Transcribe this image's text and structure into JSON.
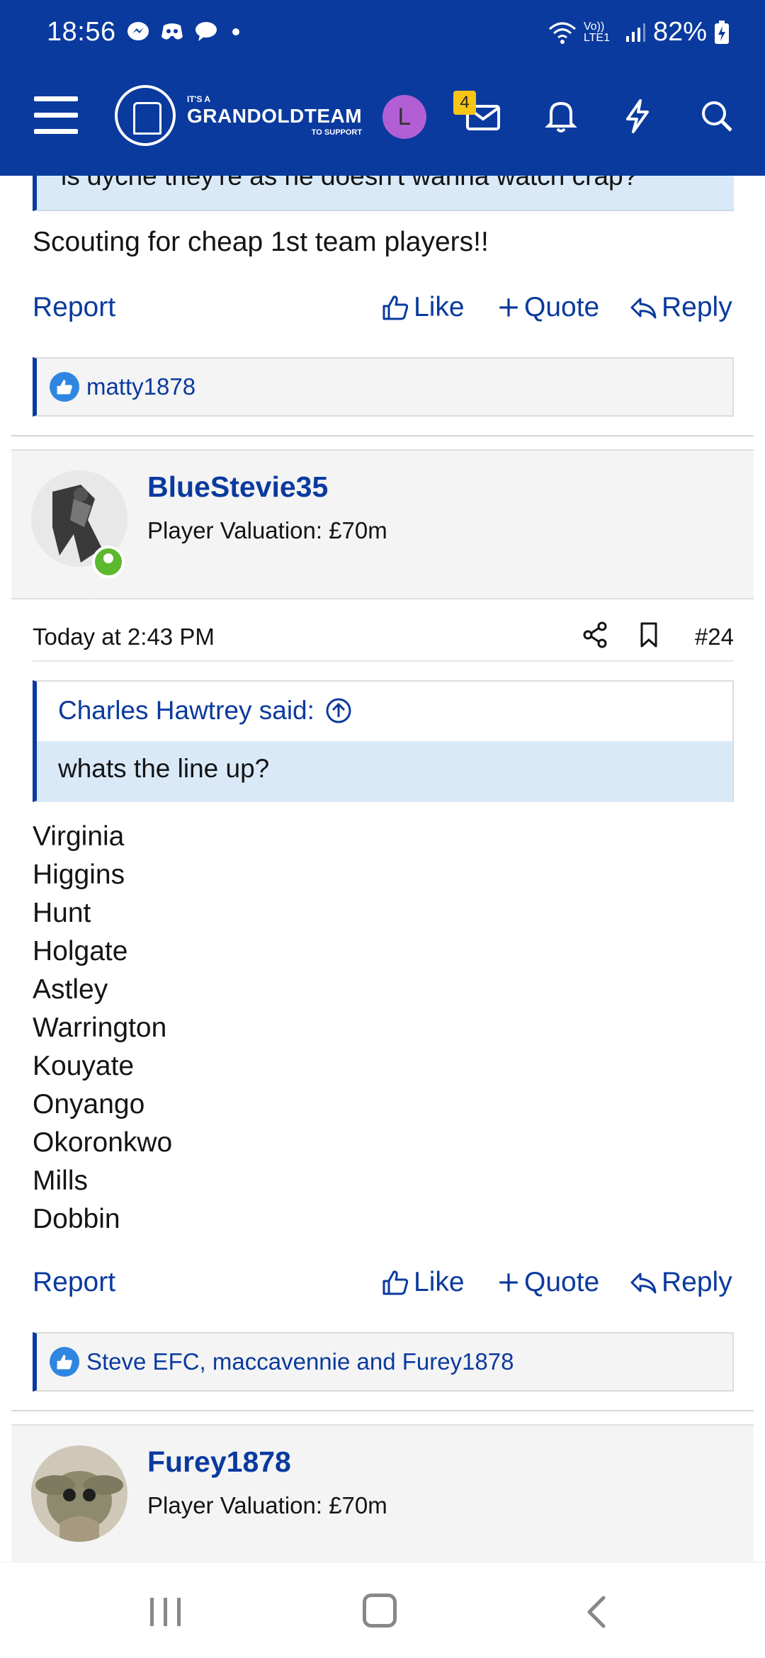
{
  "status_bar": {
    "time": "18:56",
    "network": "Vo)) LTE1",
    "battery": "82%"
  },
  "header": {
    "logo_small": "IT'S A",
    "logo_big": "GRANDOLDTEAM",
    "logo_tiny": "TO SUPPORT",
    "avatar_letter": "L",
    "inbox_badge": "4",
    "colors": {
      "brand": "#0a3a9e",
      "avatar": "#b25fd6",
      "badge": "#f7c514"
    }
  },
  "post1": {
    "quote_partial": "is dyche they're as he doesn't wanna watch crap?",
    "body": "Scouting for cheap 1st team players!!",
    "report_label": "Report",
    "like_label": "Like",
    "quote_label": "Quote",
    "reply_label": "Reply",
    "reactions": "matty1878"
  },
  "post2": {
    "username": "BlueStevie35",
    "valuation": "Player Valuation: £70m",
    "date": "Today at 2:43 PM",
    "post_number": "#24",
    "quote_author": "Charles Hawtrey said:",
    "quote_text": "whats the line up?",
    "lineup": [
      "Virginia",
      "Higgins",
      "Hunt",
      "Holgate",
      "Astley",
      "Warrington",
      "Kouyate",
      "Onyango",
      "Okoronkwo",
      "Mills",
      "Dobbin"
    ],
    "report_label": "Report",
    "like_label": "Like",
    "quote_label": "Quote",
    "reply_label": "Reply",
    "reactions": "Steve EFC, maccavennie and Furey1878"
  },
  "post3": {
    "username": "Furey1878",
    "valuation": "Player Valuation: £70m"
  }
}
